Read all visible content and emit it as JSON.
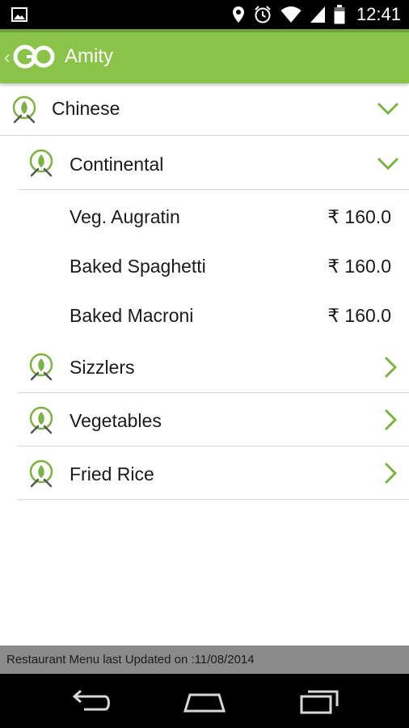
{
  "status_bar": {
    "time": "12:41",
    "icons": [
      "gallery-icon",
      "location-icon",
      "alarm-icon",
      "wifi-icon",
      "signal-icon",
      "battery-icon"
    ]
  },
  "header": {
    "logo_text": "GO",
    "title": "Amity",
    "background": "#8bc34a"
  },
  "menu": {
    "top_category": {
      "label": "Chinese",
      "expanded": true
    },
    "sub_categories": [
      {
        "label": "Continental",
        "expanded": true,
        "items": [
          {
            "name": "Veg. Augratin",
            "price": "₹ 160.0"
          },
          {
            "name": "Baked Spaghetti",
            "price": "₹ 160.0"
          },
          {
            "name": "Baked Macroni",
            "price": "₹ 160.0"
          }
        ]
      },
      {
        "label": "Sizzlers",
        "expanded": false
      },
      {
        "label": "Vegetables",
        "expanded": false
      },
      {
        "label": "Fried Rice",
        "expanded": false
      }
    ]
  },
  "footer": {
    "note": "Restaurant Menu last Updated on :11/08/2014"
  },
  "accent_color": "#7cb342"
}
